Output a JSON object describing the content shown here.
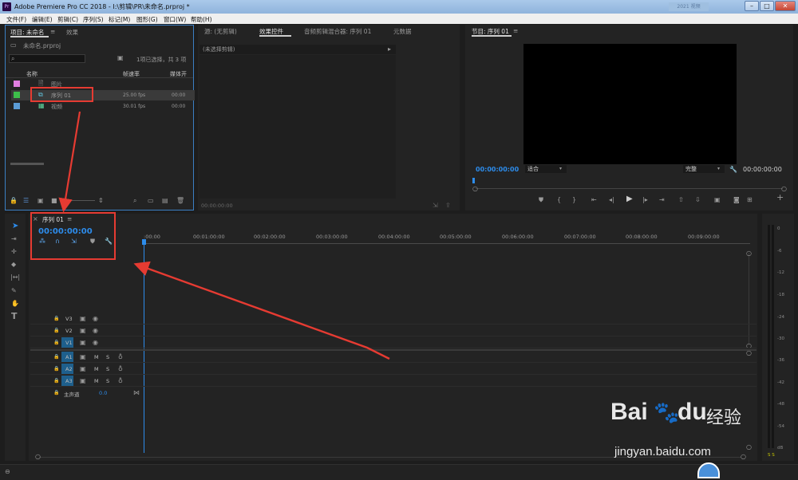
{
  "window": {
    "title": "Adobe Premiere Pro CC 2018 - I:\\剪辑\\PR\\未命名.prproj *",
    "logo_text": "Pr",
    "blurred_badge": "2021 视频",
    "minimize_label": "–",
    "maximize_label": "□",
    "close_label": "✕"
  },
  "menu": [
    "文件(F)",
    "编辑(E)",
    "剪辑(C)",
    "序列(S)",
    "标记(M)",
    "图形(G)",
    "窗口(W)",
    "帮助(H)"
  ],
  "project_panel": {
    "tabs": [
      "项目: 未命名",
      "效果"
    ],
    "tab_menu": "≡",
    "project_file": "未命名.prproj",
    "selection_info": "1项已选择，共 3 项",
    "columns": [
      "名称",
      "帧速率",
      "媒体开"
    ],
    "items": [
      {
        "name": "图片",
        "fps": "",
        "media": "",
        "color": "#e07ee0",
        "icon": "image-icon"
      },
      {
        "name": "序列 01",
        "fps": "25.00 fps",
        "media": "00:00",
        "color": "#3dbd4a",
        "icon": "sequence-icon"
      },
      {
        "name": "视频",
        "fps": "30.01 fps",
        "media": "00:00",
        "color": "#5b9bd5",
        "icon": "video-clip-icon"
      }
    ]
  },
  "source_panel": {
    "tabs": [
      "源: (无剪辑)",
      "效果控件",
      "音频剪辑混合器: 序列 01",
      "元数据"
    ],
    "no_clip": "(未选择剪辑)",
    "timecode": "00:00:00:00"
  },
  "program_panel": {
    "tab": "节目: 序列 01",
    "timecode_left": "00:00:00:00",
    "timecode_right": "00:00:00:00",
    "fit_label": "适合",
    "quality_label": "完整"
  },
  "timeline": {
    "tab": "序列 01",
    "timecode": "00:00:00:00",
    "ruler": [
      ":00:00",
      "00:01:00:00",
      "00:02:00:00",
      "00:03:00:00",
      "00:04:00:00",
      "00:05:00:00",
      "00:06:00:00",
      "00:07:00:00",
      "00:08:00:00",
      "00:09:00:00"
    ],
    "video_tracks": [
      "V3",
      "V2",
      "V1"
    ],
    "audio_tracks": [
      "A1",
      "A2",
      "A3"
    ],
    "mute": "M",
    "solo": "S",
    "master_label": "主声道",
    "master_value": "0.0"
  },
  "audio_meter": {
    "scale": [
      "0",
      "-6",
      "-12",
      "-18",
      "-24",
      "-30",
      "-36",
      "-42",
      "-48",
      "-54",
      "dB"
    ],
    "footer": "S S"
  },
  "watermark": {
    "brand": "Bai",
    "brand_end": "du",
    "cn": "经验",
    "url": "jingyan.baidu.com"
  },
  "colors": {
    "accent_blue": "#2d8ceb",
    "annotation_red": "#e63b32",
    "track_blue": "#1e5f8c"
  }
}
